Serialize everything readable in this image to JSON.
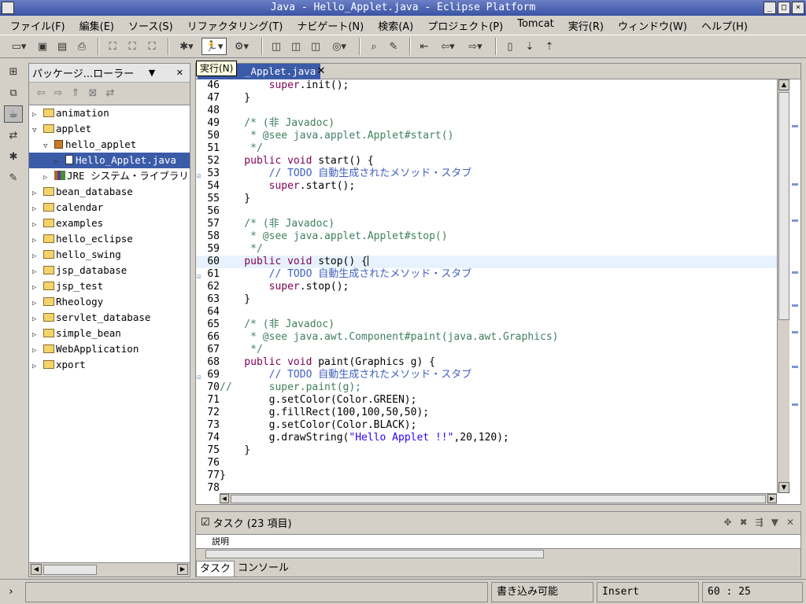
{
  "window": {
    "title": "Java - Hello_Applet.java - Eclipse Platform"
  },
  "menus": [
    "ファイル(F)",
    "編集(E)",
    "ソース(S)",
    "リファクタリング(T)",
    "ナビゲート(N)",
    "検索(A)",
    "プロジェクト(P)",
    "Tomcat",
    "実行(R)",
    "ウィンドウ(W)",
    "ヘルプ(H)"
  ],
  "tooltip": "実行(N)",
  "package_explorer": {
    "title": "パッケージ...ローラー",
    "tree": [
      {
        "label": "animation",
        "indent": 0,
        "arrow": "▷",
        "icon": "folder"
      },
      {
        "label": "applet",
        "indent": 0,
        "arrow": "▽",
        "icon": "folder"
      },
      {
        "label": "hello_applet",
        "indent": 1,
        "arrow": "▽",
        "icon": "package"
      },
      {
        "label": "Hello_Applet.java",
        "indent": 2,
        "arrow": "▷",
        "icon": "java",
        "selected": true
      },
      {
        "label": "JRE システム・ライブラリ",
        "indent": 1,
        "arrow": "▷",
        "icon": "library"
      },
      {
        "label": "bean_database",
        "indent": 0,
        "arrow": "▷",
        "icon": "folder"
      },
      {
        "label": "calendar",
        "indent": 0,
        "arrow": "▷",
        "icon": "folder"
      },
      {
        "label": "examples",
        "indent": 0,
        "arrow": "▷",
        "icon": "folder"
      },
      {
        "label": "hello_eclipse",
        "indent": 0,
        "arrow": "▷",
        "icon": "folder"
      },
      {
        "label": "hello_swing",
        "indent": 0,
        "arrow": "▷",
        "icon": "folder"
      },
      {
        "label": "jsp_database",
        "indent": 0,
        "arrow": "▷",
        "icon": "folder"
      },
      {
        "label": "jsp_test",
        "indent": 0,
        "arrow": "▷",
        "icon": "folder"
      },
      {
        "label": "Rheology",
        "indent": 0,
        "arrow": "▷",
        "icon": "folder"
      },
      {
        "label": "servlet_database",
        "indent": 0,
        "arrow": "▷",
        "icon": "folder"
      },
      {
        "label": "simple_bean",
        "indent": 0,
        "arrow": "▷",
        "icon": "folder"
      },
      {
        "label": "WebApplication",
        "indent": 0,
        "arrow": "▷",
        "icon": "folder"
      },
      {
        "label": "xport",
        "indent": 0,
        "arrow": "▷",
        "icon": "folder"
      }
    ]
  },
  "editor": {
    "tab_label": "_Applet.java",
    "lines": [
      {
        "n": "46",
        "segs": [
          [
            "",
            "        "
          ],
          [
            "kw",
            "super"
          ],
          [
            "",
            ".init();"
          ]
        ]
      },
      {
        "n": "47",
        "segs": [
          [
            "",
            "    }"
          ]
        ]
      },
      {
        "n": "48",
        "segs": []
      },
      {
        "n": "49",
        "segs": [
          [
            "cm",
            "    /* (非 Javadoc)"
          ]
        ]
      },
      {
        "n": "50",
        "segs": [
          [
            "cm",
            "     * @see java.applet.Applet#start()"
          ]
        ]
      },
      {
        "n": "51",
        "segs": [
          [
            "cm",
            "     */"
          ]
        ]
      },
      {
        "n": "52",
        "segs": [
          [
            "kw",
            "    public void"
          ],
          [
            "",
            " start() {"
          ]
        ]
      },
      {
        "n": "53",
        "marker": true,
        "segs": [
          [
            "ct",
            "        // TODO 自動生成されたメソッド・スタブ"
          ]
        ]
      },
      {
        "n": "54",
        "segs": [
          [
            "kw",
            "        super"
          ],
          [
            "",
            ".start();"
          ]
        ]
      },
      {
        "n": "55",
        "segs": [
          [
            "",
            "    }"
          ]
        ]
      },
      {
        "n": "56",
        "segs": []
      },
      {
        "n": "57",
        "segs": [
          [
            "cm",
            "    /* (非 Javadoc)"
          ]
        ]
      },
      {
        "n": "58",
        "segs": [
          [
            "cm",
            "     * @see java.applet.Applet#stop()"
          ]
        ]
      },
      {
        "n": "59",
        "segs": [
          [
            "cm",
            "     */"
          ]
        ]
      },
      {
        "n": "60",
        "hl": true,
        "caret": true,
        "segs": [
          [
            "kw",
            "    public void"
          ],
          [
            "",
            " stop() {"
          ]
        ]
      },
      {
        "n": "61",
        "marker": true,
        "segs": [
          [
            "ct",
            "        // TODO 自動生成されたメソッド・スタブ"
          ]
        ]
      },
      {
        "n": "62",
        "segs": [
          [
            "kw",
            "        super"
          ],
          [
            "",
            ".stop();"
          ]
        ]
      },
      {
        "n": "63",
        "segs": [
          [
            "",
            "    }"
          ]
        ]
      },
      {
        "n": "64",
        "segs": []
      },
      {
        "n": "65",
        "segs": [
          [
            "cm",
            "    /* (非 Javadoc)"
          ]
        ]
      },
      {
        "n": "66",
        "segs": [
          [
            "cm",
            "     * @see java.awt.Component#paint(java.awt.Graphics)"
          ]
        ]
      },
      {
        "n": "67",
        "segs": [
          [
            "cm",
            "     */"
          ]
        ]
      },
      {
        "n": "68",
        "segs": [
          [
            "kw",
            "    public void"
          ],
          [
            "",
            " paint(Graphics g) {"
          ]
        ]
      },
      {
        "n": "69",
        "marker": true,
        "segs": [
          [
            "ct",
            "        // TODO 自動生成されたメソッド・スタブ"
          ]
        ]
      },
      {
        "n": "70",
        "segs": [
          [
            "cm",
            "//      super.paint(g);"
          ]
        ]
      },
      {
        "n": "71",
        "segs": [
          [
            "",
            "        g.setColor(Color.GREEN);"
          ]
        ]
      },
      {
        "n": "72",
        "segs": [
          [
            "",
            "        g.fillRect(100,100,50,50);"
          ]
        ]
      },
      {
        "n": "73",
        "segs": [
          [
            "",
            "        g.setColor(Color.BLACK);"
          ]
        ]
      },
      {
        "n": "74",
        "segs": [
          [
            "",
            "        g.drawString("
          ],
          [
            "str",
            "\"Hello Applet !!\""
          ],
          [
            "",
            ",20,120);"
          ]
        ]
      },
      {
        "n": "75",
        "segs": [
          [
            "",
            "    }"
          ]
        ]
      },
      {
        "n": "76",
        "segs": []
      },
      {
        "n": "77",
        "segs": [
          [
            "",
            "}"
          ]
        ]
      },
      {
        "n": "78",
        "segs": []
      }
    ]
  },
  "tasks": {
    "title": "タスク (23 項目)",
    "column": "説明",
    "tabs": [
      "タスク",
      "コンソール"
    ]
  },
  "status": {
    "writable": "書き込み可能",
    "mode": "Insert",
    "position": "60 : 25"
  }
}
